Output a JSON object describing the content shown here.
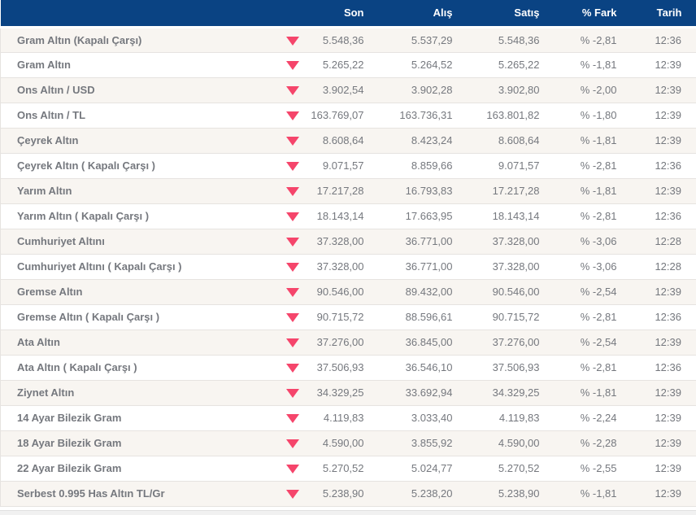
{
  "header": {
    "columns": [
      "Son",
      "Alış",
      "Satış",
      "% Fark",
      "Tarih"
    ]
  },
  "table": {
    "rows": [
      {
        "name": "Gram Altın (Kapalı Çarşı)",
        "son": "5.548,36",
        "alis": "5.537,29",
        "satis": "5.548,36",
        "fark": "% -2,81",
        "tarih": "12:36"
      },
      {
        "name": "Gram Altın",
        "son": "5.265,22",
        "alis": "5.264,52",
        "satis": "5.265,22",
        "fark": "% -1,81",
        "tarih": "12:39"
      },
      {
        "name": "Ons Altın / USD",
        "son": "3.902,54",
        "alis": "3.902,28",
        "satis": "3.902,80",
        "fark": "% -2,00",
        "tarih": "12:39"
      },
      {
        "name": "Ons Altın / TL",
        "son": "163.769,07",
        "alis": "163.736,31",
        "satis": "163.801,82",
        "fark": "% -1,80",
        "tarih": "12:39"
      },
      {
        "name": "Çeyrek Altın",
        "son": "8.608,64",
        "alis": "8.423,24",
        "satis": "8.608,64",
        "fark": "% -1,81",
        "tarih": "12:39"
      },
      {
        "name": "Çeyrek Altın ( Kapalı Çarşı )",
        "son": "9.071,57",
        "alis": "8.859,66",
        "satis": "9.071,57",
        "fark": "% -2,81",
        "tarih": "12:36"
      },
      {
        "name": "Yarım Altın",
        "son": "17.217,28",
        "alis": "16.793,83",
        "satis": "17.217,28",
        "fark": "% -1,81",
        "tarih": "12:39"
      },
      {
        "name": "Yarım Altın ( Kapalı Çarşı )",
        "son": "18.143,14",
        "alis": "17.663,95",
        "satis": "18.143,14",
        "fark": "% -2,81",
        "tarih": "12:36"
      },
      {
        "name": "Cumhuriyet Altını",
        "son": "37.328,00",
        "alis": "36.771,00",
        "satis": "37.328,00",
        "fark": "% -3,06",
        "tarih": "12:28"
      },
      {
        "name": "Cumhuriyet Altını ( Kapalı Çarşı )",
        "son": "37.328,00",
        "alis": "36.771,00",
        "satis": "37.328,00",
        "fark": "% -3,06",
        "tarih": "12:28"
      },
      {
        "name": "Gremse Altın",
        "son": "90.546,00",
        "alis": "89.432,00",
        "satis": "90.546,00",
        "fark": "% -2,54",
        "tarih": "12:39"
      },
      {
        "name": "Gremse Altın ( Kapalı Çarşı )",
        "son": "90.715,72",
        "alis": "88.596,61",
        "satis": "90.715,72",
        "fark": "% -2,81",
        "tarih": "12:36"
      },
      {
        "name": "Ata Altın",
        "son": "37.276,00",
        "alis": "36.845,00",
        "satis": "37.276,00",
        "fark": "% -2,54",
        "tarih": "12:39"
      },
      {
        "name": "Ata Altın ( Kapalı Çarşı )",
        "son": "37.506,93",
        "alis": "36.546,10",
        "satis": "37.506,93",
        "fark": "% -2,81",
        "tarih": "12:36"
      },
      {
        "name": "Ziynet Altın",
        "son": "34.329,25",
        "alis": "33.692,94",
        "satis": "34.329,25",
        "fark": "% -1,81",
        "tarih": "12:39"
      },
      {
        "name": "14 Ayar Bilezik Gram",
        "son": "4.119,83",
        "alis": "3.033,40",
        "satis": "4.119,83",
        "fark": "% -2,24",
        "tarih": "12:39"
      },
      {
        "name": "18 Ayar Bilezik Gram",
        "son": "4.590,00",
        "alis": "3.855,92",
        "satis": "4.590,00",
        "fark": "% -2,28",
        "tarih": "12:39"
      },
      {
        "name": "22 Ayar Bilezik Gram",
        "son": "5.270,52",
        "alis": "5.024,77",
        "satis": "5.270,52",
        "fark": "% -2,55",
        "tarih": "12:39"
      },
      {
        "name": "Serbest 0.995 Has Altın TL/Gr",
        "son": "5.238,90",
        "alis": "5.238,20",
        "satis": "5.238,90",
        "fark": "% -1,81",
        "tarih": "12:39"
      }
    ]
  },
  "icons": {
    "trend_down": "down-triangle"
  },
  "colors": {
    "header-bg": "#0a4383",
    "header-fg": "#ffffff",
    "name-fg": "#1e4796",
    "num-fg": "#75787e",
    "arrow": "#f5456b",
    "row-odd": "#f8f5f1",
    "row-even": "#ffffff",
    "row-border": "#e6e3e0",
    "strip-bg": "#f1f1f1",
    "strip-border": "#e0e0e0"
  }
}
